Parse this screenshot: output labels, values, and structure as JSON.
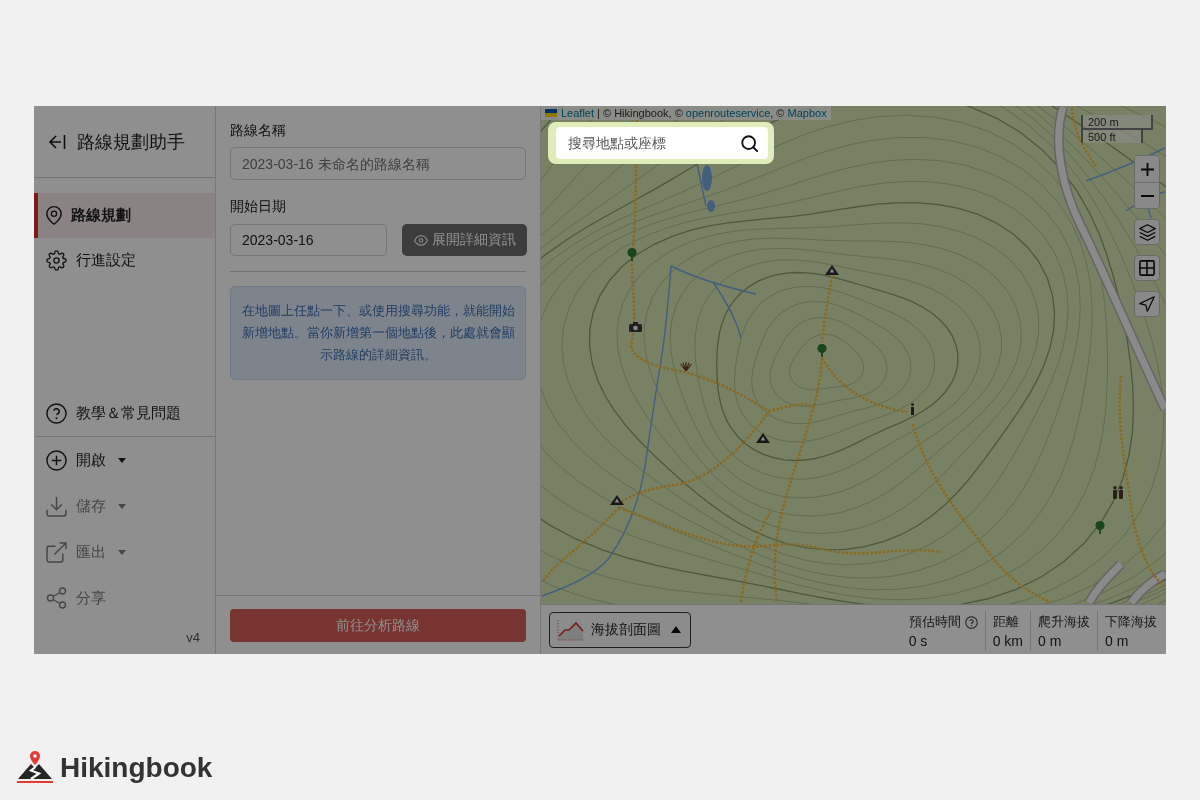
{
  "overlay": {
    "dimmed": true
  },
  "sidebar": {
    "title": "路線規劃助手",
    "nav": [
      {
        "label": "路線規劃",
        "selected": true
      },
      {
        "label": "行進設定",
        "selected": false
      }
    ],
    "help": {
      "label": "教學＆常見問題"
    },
    "actions": [
      {
        "label": "開啟",
        "dropdown": true,
        "disabled": false
      },
      {
        "label": "儲存",
        "dropdown": true,
        "disabled": true
      },
      {
        "label": "匯出",
        "dropdown": true,
        "disabled": true
      },
      {
        "label": "分享",
        "dropdown": false,
        "disabled": true
      }
    ],
    "version": "v4"
  },
  "form": {
    "route_name": {
      "label": "路線名稱",
      "placeholder": "2023-03-16 未命名的路線名稱"
    },
    "start_date": {
      "label": "開始日期",
      "value": "2023-03-16"
    },
    "details_button": "展開詳細資訊",
    "hint": "在地圖上任點一下、或使用搜尋功能，就能開始新增地點。當你新增第一個地點後，此處就會顯示路線的詳細資訊。",
    "analyze_button": {
      "label": "前往分析路線",
      "disabled": true
    }
  },
  "map": {
    "attribution": [
      {
        "text": "Leaflet",
        "link": true
      },
      {
        "text": " | © Hikingbook, © ",
        "link": false
      },
      {
        "text": "openrouteservice",
        "link": true
      },
      {
        "text": ", © ",
        "link": false
      },
      {
        "text": "Mapbox",
        "link": true
      }
    ],
    "search": {
      "placeholder": "搜尋地點或座標",
      "highlighted": true
    },
    "scale": [
      "200 m",
      "500 ft"
    ]
  },
  "bottom_bar": {
    "profile_button": "海拔剖面圖",
    "stats": [
      {
        "label": "預估時間",
        "value": "0 s",
        "info": true
      },
      {
        "label": "距離",
        "value": "0 km",
        "info": false
      },
      {
        "label": "爬升海拔",
        "value": "0 m",
        "info": false
      },
      {
        "label": "下降海拔",
        "value": "0 m",
        "info": false
      }
    ]
  },
  "brand": {
    "name": "Hikingbook"
  }
}
